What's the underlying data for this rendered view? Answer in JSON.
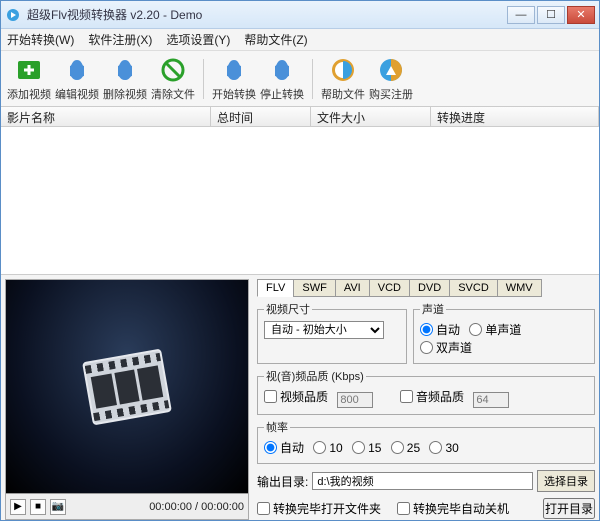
{
  "title": "超级Flv视频转换器 v2.20 - Demo",
  "menus": [
    "开始转换(W)",
    "软件注册(X)",
    "选项设置(Y)",
    "帮助文件(Z)"
  ],
  "toolbar": [
    {
      "label": "添加视频",
      "name": "add-video"
    },
    {
      "label": "编辑视频",
      "name": "edit-video"
    },
    {
      "label": "删除视频",
      "name": "remove-video"
    },
    {
      "label": "清除文件",
      "name": "clear-files"
    },
    {
      "label": "开始转换",
      "name": "start-convert"
    },
    {
      "label": "停止转换",
      "name": "stop-convert"
    },
    {
      "label": "帮助文件",
      "name": "help"
    },
    {
      "label": "购买注册",
      "name": "buy"
    }
  ],
  "columns": {
    "name": "影片名称",
    "duration": "总时间",
    "size": "文件大小",
    "progress": "转换进度"
  },
  "preview": {
    "time": "00:00:00 / 00:00:00"
  },
  "tabs": [
    "FLV",
    "SWF",
    "AVI",
    "VCD",
    "DVD",
    "SVCD",
    "WMV"
  ],
  "videoSize": {
    "legend": "视频尺寸",
    "value": "自动 - 初始大小"
  },
  "audio": {
    "legend": "声道",
    "opts": [
      "自动",
      "单声道",
      "双声道"
    ]
  },
  "quality": {
    "legend": "视(音)频品质 (Kbps)",
    "vlabel": "视频品质",
    "vval": "800",
    "alabel": "音频品质",
    "aval": "64"
  },
  "fps": {
    "legend": "帧率",
    "opts": [
      "自动",
      "10",
      "15",
      "25",
      "30"
    ]
  },
  "output": {
    "label": "输出目录:",
    "path": "d:\\我的视频",
    "btn": "选择目录"
  },
  "bottom": {
    "open": "转换完毕打开文件夹",
    "shutdown": "转换完毕自动关机",
    "openbtn": "打开目录"
  }
}
